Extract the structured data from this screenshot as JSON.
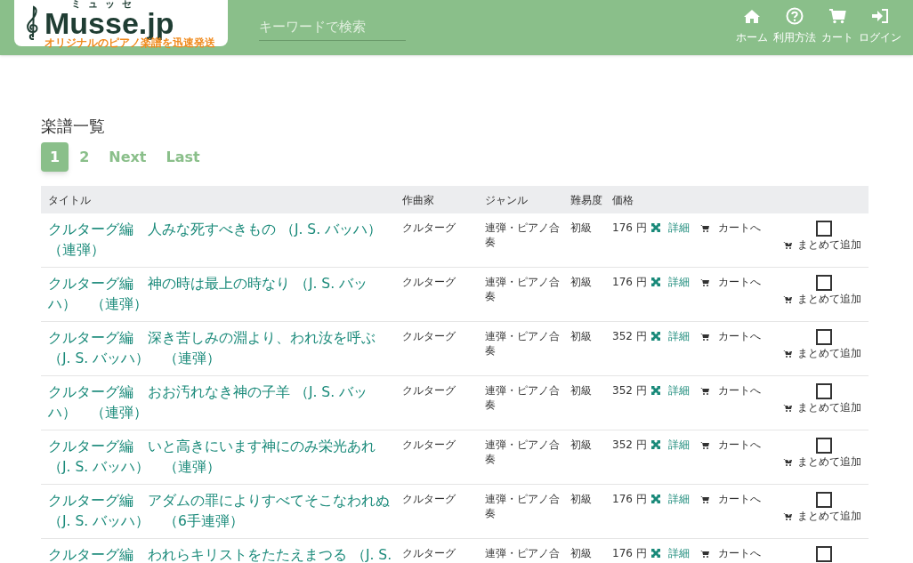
{
  "header": {
    "logo": {
      "title": "Musse.jp",
      "reading": "ミュッセ",
      "tagline": "オリジナルのピアノ楽譜を迅速発送"
    },
    "search": {
      "placeholder": "キーワードで検索"
    },
    "nav": [
      {
        "kind": "home",
        "label": "ホーム"
      },
      {
        "kind": "help",
        "label": "利用方法"
      },
      {
        "kind": "cart",
        "label": "カート"
      },
      {
        "kind": "login",
        "label": "ログイン"
      }
    ]
  },
  "heading": "楽譜一覧",
  "pagination": [
    {
      "label": "1",
      "selected": true
    },
    {
      "label": "2",
      "selected": false
    },
    {
      "label": "Next",
      "selected": false
    },
    {
      "label": "Last",
      "selected": false
    }
  ],
  "table": {
    "columns": [
      "タイトル",
      "作曲家",
      "ジャンル",
      "難易度",
      "価格"
    ],
    "rows": [
      {
        "title": "クルターグ編　人みな死すべきもの （J. S. バッハ）（連弾）",
        "composer": "クルターグ",
        "genre": "連弾・ピアノ合奏",
        "level": "初級",
        "price": "176 円",
        "detail": "詳細",
        "cart": "カートへ",
        "bulk": "まとめて追加",
        "checked": false
      },
      {
        "title": "クルターグ編　神の時は最上の時なり （J. S. バッハ）　（連弾）",
        "composer": "クルターグ",
        "genre": "連弾・ピアノ合奏",
        "level": "初級",
        "price": "176 円",
        "detail": "詳細",
        "cart": "カートへ",
        "bulk": "まとめて追加",
        "checked": false
      },
      {
        "title": "クルターグ編　深き苦しみの淵より、われ汝を呼ぶ（J. S. バッハ）　（連弾）",
        "composer": "クルターグ",
        "genre": "連弾・ピアノ合奏",
        "level": "初級",
        "price": "352 円",
        "detail": "詳細",
        "cart": "カートへ",
        "bulk": "まとめて追加",
        "checked": false
      },
      {
        "title": "クルターグ編　おお汚れなき神の子羊 （J. S. バッハ）　（連弾）",
        "composer": "クルターグ",
        "genre": "連弾・ピアノ合奏",
        "level": "初級",
        "price": "352 円",
        "detail": "詳細",
        "cart": "カートへ",
        "bulk": "まとめて追加",
        "checked": false
      },
      {
        "title": "クルターグ編　いと高きにいます神にのみ栄光あれ（J. S. バッハ）　（連弾）",
        "composer": "クルターグ",
        "genre": "連弾・ピアノ合奏",
        "level": "初級",
        "price": "352 円",
        "detail": "詳細",
        "cart": "カートへ",
        "bulk": "まとめて追加",
        "checked": false
      },
      {
        "title": "クルターグ編　アダムの罪によりすべてそこなわれぬ（J. S. バッハ）　（6手連弾）",
        "composer": "クルターグ",
        "genre": "連弾・ピアノ合奏",
        "level": "初級",
        "price": "176 円",
        "detail": "詳細",
        "cart": "カートへ",
        "bulk": "まとめて追加",
        "checked": false
      },
      {
        "title": "クルターグ編　われらキリストをたたえまつる （J. S.",
        "composer": "クルターグ",
        "genre": "連弾・ピアノ合",
        "level": "初級",
        "price": "176 円",
        "detail": "詳細",
        "cart": "カートへ",
        "checked": false
      }
    ]
  }
}
